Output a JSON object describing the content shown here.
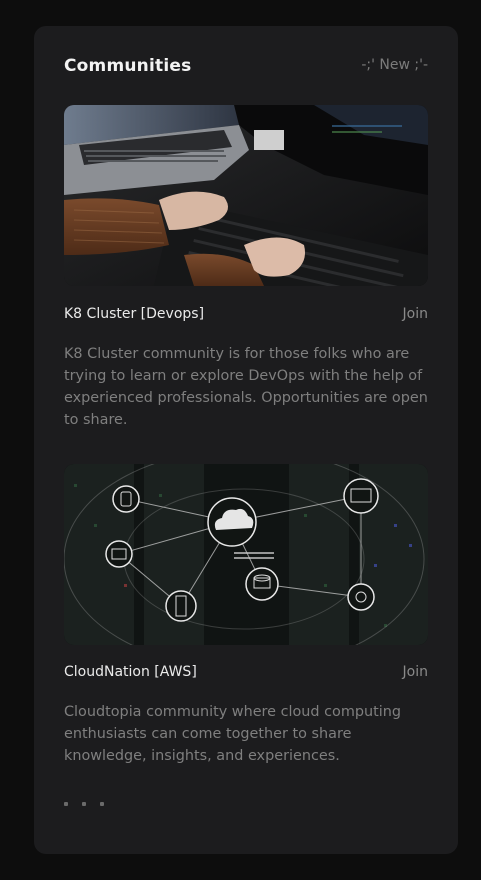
{
  "header": {
    "title": "Communities",
    "new_label": "-;' New ;'-"
  },
  "communities": [
    {
      "name": "K8 Cluster [Devops]",
      "join_label": "Join",
      "description": "K8 Cluster community is for those folks who are trying to learn or explore DevOps with the help of experienced professionals. Opportunities are open to share.",
      "image": "laptop-keyboard-photo"
    },
    {
      "name": "CloudNation [AWS]",
      "join_label": "Join",
      "description": "Cloudtopia community where cloud computing enthusiasts can come together to share knowledge, insights, and experiences.",
      "image": "cloud-network-illustration"
    }
  ],
  "more_indicator": "three-dots-icon",
  "colors": {
    "page_bg": "#0d0d0d",
    "card_bg": "#1c1c1e",
    "title_text": "#f3f3f3",
    "muted_text": "#7f7f7f"
  }
}
